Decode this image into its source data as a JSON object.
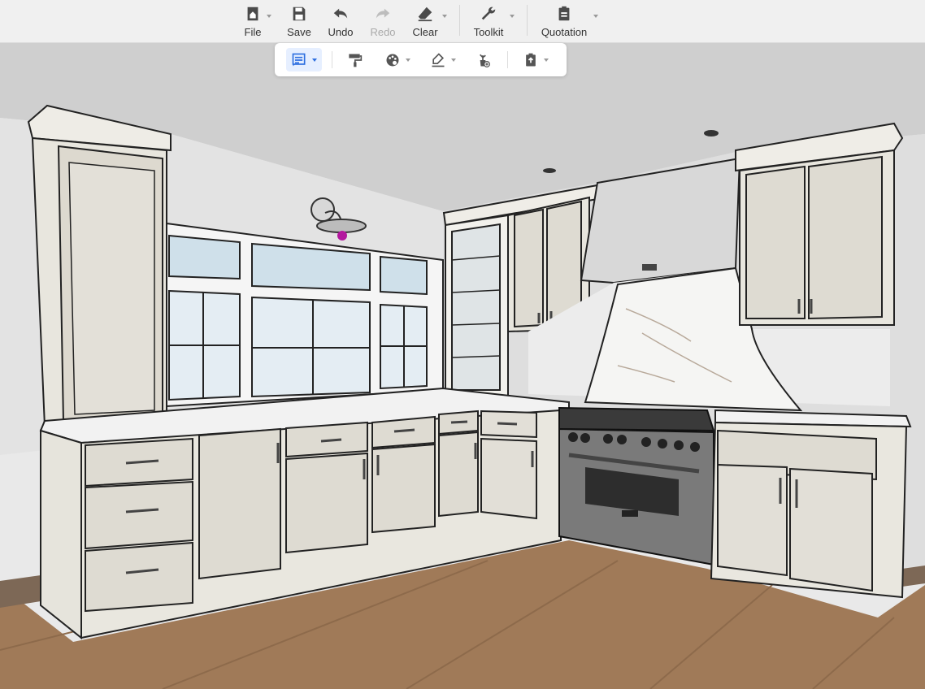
{
  "toolbar": {
    "file_label": "File",
    "save_label": "Save",
    "undo_label": "Undo",
    "redo_label": "Redo",
    "clear_label": "Clear",
    "toolkit_label": "Toolkit",
    "quotation_label": "Quotation"
  },
  "subtoolbar": {
    "items": [
      {
        "icon": "notes-list-icon",
        "active": true
      },
      {
        "icon": "paint-roller-icon",
        "active": false
      },
      {
        "icon": "color-palette-icon",
        "active": false
      },
      {
        "icon": "eraser-brush-icon",
        "active": false
      },
      {
        "icon": "decor-plant-icon",
        "active": false
      },
      {
        "icon": "clipboard-icon",
        "active": false
      }
    ]
  },
  "colors": {
    "accent": "#2d6fe0",
    "toolbar_bg": "#f0f0f0",
    "cabinet": "#e6e4dc",
    "floor": "#a07a58",
    "wall": "#e8e8e8"
  }
}
